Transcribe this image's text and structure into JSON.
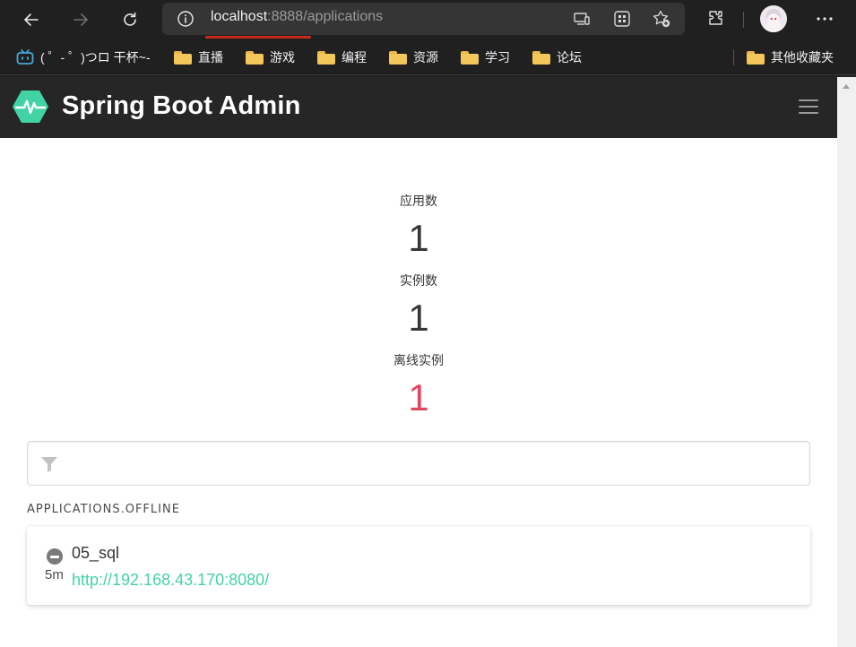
{
  "browser": {
    "url_host": "localhost",
    "url_rest": ":8888/applications",
    "bookmarks": [
      {
        "label": "( ゜- ゜)つロ 干杯~-",
        "icon": "bilibili-icon"
      },
      {
        "label": "直播",
        "icon": "folder-icon"
      },
      {
        "label": "游戏",
        "icon": "folder-icon"
      },
      {
        "label": "编程",
        "icon": "folder-icon"
      },
      {
        "label": "资源",
        "icon": "folder-icon"
      },
      {
        "label": "学习",
        "icon": "folder-icon"
      },
      {
        "label": "论坛",
        "icon": "folder-icon"
      }
    ],
    "other_bookmarks": "其他收藏夹"
  },
  "app": {
    "brand": "Spring Boot Admin",
    "brand_color": "#42d3a5"
  },
  "stats": {
    "applications_label": "应用数",
    "applications_value": "1",
    "instances_label": "实例数",
    "instances_value": "1",
    "offline_label": "离线实例",
    "offline_value": "1",
    "offline_color": "#e0475f"
  },
  "filter": {
    "placeholder": "",
    "value": ""
  },
  "section": {
    "title": "APPLICATIONS.OFFLINE"
  },
  "applications": [
    {
      "name": "05_sql",
      "since": "5m",
      "url": "http://192.168.43.170:8080/",
      "status_icon": "minus-circle-icon"
    }
  ]
}
